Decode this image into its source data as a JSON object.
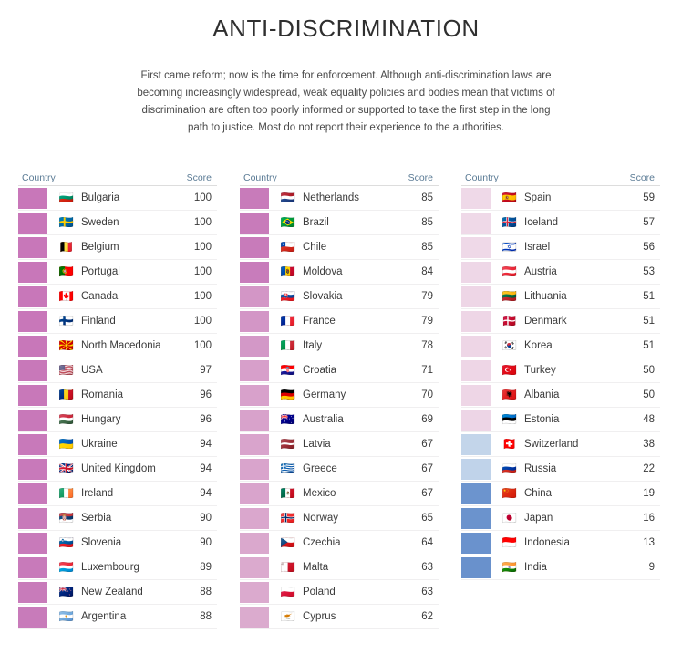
{
  "header": {
    "title": "ANTI-DISCRIMINATION",
    "intro": "First came reform; now is the time for enforcement. Although anti-discrimination laws are becoming increasingly widespread, weak equality policies and bodies mean that victims of discrimination are often too poorly informed or supported to take the first step in the long path to justice. Most do not report their experience to the authorities."
  },
  "columns": [
    {
      "headers": {
        "country": "Country",
        "score": "Score"
      },
      "rows": [
        {
          "country": "Bulgaria",
          "score": 100,
          "flag": "flag-bulgaria",
          "glyph": "🇧🇬",
          "color": "#c877b9"
        },
        {
          "country": "Sweden",
          "score": 100,
          "flag": "flag-sweden",
          "glyph": "🇸🇪",
          "color": "#c877b9"
        },
        {
          "country": "Belgium",
          "score": 100,
          "flag": "flag-belgium",
          "glyph": "🇧🇪",
          "color": "#c877b9"
        },
        {
          "country": "Portugal",
          "score": 100,
          "flag": "flag-portugal",
          "glyph": "🇵🇹",
          "color": "#c877b9"
        },
        {
          "country": "Canada",
          "score": 100,
          "flag": "flag-canada",
          "glyph": "🇨🇦",
          "color": "#c877b9"
        },
        {
          "country": "Finland",
          "score": 100,
          "flag": "flag-finland",
          "glyph": "🇫🇮",
          "color": "#c877b9"
        },
        {
          "country": "North Macedonia",
          "score": 100,
          "flag": "flag-north-macedonia",
          "glyph": "🇲🇰",
          "color": "#c877b9"
        },
        {
          "country": "USA",
          "score": 97,
          "flag": "flag-usa",
          "glyph": "🇺🇸",
          "color": "#c878b9"
        },
        {
          "country": "Romania",
          "score": 96,
          "flag": "flag-romania",
          "glyph": "🇷🇴",
          "color": "#c878b9"
        },
        {
          "country": "Hungary",
          "score": 96,
          "flag": "flag-hungary",
          "glyph": "🇭🇺",
          "color": "#c878b9"
        },
        {
          "country": "Ukraine",
          "score": 94,
          "flag": "flag-ukraine",
          "glyph": "🇺🇦",
          "color": "#c879ba"
        },
        {
          "country": "United Kingdom",
          "score": 94,
          "flag": "flag-united-kingdom",
          "glyph": "🇬🇧",
          "color": "#c879ba"
        },
        {
          "country": "Ireland",
          "score": 94,
          "flag": "flag-ireland",
          "glyph": "🇮🇪",
          "color": "#c879ba"
        },
        {
          "country": "Serbia",
          "score": 90,
          "flag": "flag-serbia",
          "glyph": "🇷🇸",
          "color": "#c87aba"
        },
        {
          "country": "Slovenia",
          "score": 90,
          "flag": "flag-slovenia",
          "glyph": "🇸🇮",
          "color": "#c87aba"
        },
        {
          "country": "Luxembourg",
          "score": 89,
          "flag": "flag-luxembourg",
          "glyph": "🇱🇺",
          "color": "#c87aba"
        },
        {
          "country": "New Zealand",
          "score": 88,
          "flag": "flag-new-zealand",
          "glyph": "🇳🇿",
          "color": "#c87bba"
        },
        {
          "country": "Argentina",
          "score": 88,
          "flag": "flag-argentina",
          "glyph": "🇦🇷",
          "color": "#c87bba"
        }
      ]
    },
    {
      "headers": {
        "country": "Country",
        "score": "Score"
      },
      "rows": [
        {
          "country": "Netherlands",
          "score": 85,
          "flag": "flag-netherlands",
          "glyph": "🇳🇱",
          "color": "#c87bba"
        },
        {
          "country": "Brazil",
          "score": 85,
          "flag": "flag-brazil",
          "glyph": "🇧🇷",
          "color": "#c87bba"
        },
        {
          "country": "Chile",
          "score": 85,
          "flag": "flag-chile",
          "glyph": "🇨🇱",
          "color": "#c87bba"
        },
        {
          "country": "Moldova",
          "score": 84,
          "flag": "flag-moldova",
          "glyph": "🇲🇩",
          "color": "#c87cbb"
        },
        {
          "country": "Slovakia",
          "score": 79,
          "flag": "flag-slovakia",
          "glyph": "🇸🇰",
          "color": "#d396c6"
        },
        {
          "country": "France",
          "score": 79,
          "flag": "flag-france",
          "glyph": "🇫🇷",
          "color": "#d396c6"
        },
        {
          "country": "Italy",
          "score": 78,
          "flag": "flag-italy",
          "glyph": "🇮🇹",
          "color": "#d398c7"
        },
        {
          "country": "Croatia",
          "score": 71,
          "flag": "flag-croatia",
          "glyph": "🇭🇷",
          "color": "#d79fca"
        },
        {
          "country": "Germany",
          "score": 70,
          "flag": "flag-germany",
          "glyph": "🇩🇪",
          "color": "#d8a1cb"
        },
        {
          "country": "Australia",
          "score": 69,
          "flag": "flag-australia",
          "glyph": "🇦🇺",
          "color": "#d8a2cb"
        },
        {
          "country": "Latvia",
          "score": 67,
          "flag": "flag-latvia",
          "glyph": "🇱🇻",
          "color": "#d9a4cc"
        },
        {
          "country": "Greece",
          "score": 67,
          "flag": "flag-greece",
          "glyph": "🇬🇷",
          "color": "#d9a4cc"
        },
        {
          "country": "Mexico",
          "score": 67,
          "flag": "flag-mexico",
          "glyph": "🇲🇽",
          "color": "#d9a4cc"
        },
        {
          "country": "Norway",
          "score": 65,
          "flag": "flag-norway",
          "glyph": "🇳🇴",
          "color": "#daa7cd"
        },
        {
          "country": "Czechia",
          "score": 64,
          "flag": "flag-czechia",
          "glyph": "🇨🇿",
          "color": "#daa8cd"
        },
        {
          "country": "Malta",
          "score": 63,
          "flag": "flag-malta",
          "glyph": "🇲🇹",
          "color": "#dbaace"
        },
        {
          "country": "Poland",
          "score": 63,
          "flag": "flag-poland",
          "glyph": "🇵🇱",
          "color": "#dbaace"
        },
        {
          "country": "Cyprus",
          "score": 62,
          "flag": "flag-cyprus",
          "glyph": "🇨🇾",
          "color": "#dbabce"
        }
      ]
    },
    {
      "headers": {
        "country": "Country",
        "score": "Score"
      },
      "rows": [
        {
          "country": "Spain",
          "score": 59,
          "flag": "flag-spain",
          "glyph": "🇪🇸",
          "color": "#efd9e8"
        },
        {
          "country": "Iceland",
          "score": 57,
          "flag": "flag-iceland",
          "glyph": "🇮🇸",
          "color": "#efd9e8"
        },
        {
          "country": "Israel",
          "score": 56,
          "flag": "flag-israel",
          "glyph": "🇮🇱",
          "color": "#efd9e8"
        },
        {
          "country": "Austria",
          "score": 53,
          "flag": "flag-austria",
          "glyph": "🇦🇹",
          "color": "#eed7e7"
        },
        {
          "country": "Lithuania",
          "score": 51,
          "flag": "flag-lithuania",
          "glyph": "🇱🇹",
          "color": "#eed6e6"
        },
        {
          "country": "Denmark",
          "score": 51,
          "flag": "flag-denmark",
          "glyph": "🇩🇰",
          "color": "#eed6e6"
        },
        {
          "country": "Korea",
          "score": 51,
          "flag": "flag-korea",
          "glyph": "🇰🇷",
          "color": "#eed6e6"
        },
        {
          "country": "Turkey",
          "score": 50,
          "flag": "flag-turkey",
          "glyph": "🇹🇷",
          "color": "#eed6e6"
        },
        {
          "country": "Albania",
          "score": 50,
          "flag": "flag-albania",
          "glyph": "🇦🇱",
          "color": "#eed6e6"
        },
        {
          "country": "Estonia",
          "score": 48,
          "flag": "flag-estonia",
          "glyph": "🇪🇪",
          "color": "#edd5e6"
        },
        {
          "country": "Switzerland",
          "score": 38,
          "flag": "flag-switzerland",
          "glyph": "🇨🇭",
          "color": "#c3d5ea"
        },
        {
          "country": "Russia",
          "score": 22,
          "flag": "flag-russia",
          "glyph": "🇷🇺",
          "color": "#c0d3ea"
        },
        {
          "country": "China",
          "score": 19,
          "flag": "flag-china",
          "glyph": "🇨🇳",
          "color": "#6c94ce"
        },
        {
          "country": "Japan",
          "score": 16,
          "flag": "flag-japan",
          "glyph": "🇯🇵",
          "color": "#6b93cd"
        },
        {
          "country": "Indonesia",
          "score": 13,
          "flag": "flag-indonesia",
          "glyph": "🇮🇩",
          "color": "#6a92cd"
        },
        {
          "country": "India",
          "score": 9,
          "flag": "flag-india",
          "glyph": "🇮🇳",
          "color": "#6991cc"
        }
      ]
    }
  ],
  "chart_data": {
    "type": "table",
    "title": "ANTI-DISCRIMINATION",
    "xlabel": "Country",
    "ylabel": "Score",
    "ylim": [
      0,
      100
    ],
    "colorscale": {
      "high": "#c877b9",
      "mid": "#dbabce",
      "low_light": "#c0d3ea",
      "low": "#6991cc"
    },
    "categories": [
      "Bulgaria",
      "Sweden",
      "Belgium",
      "Portugal",
      "Canada",
      "Finland",
      "North Macedonia",
      "USA",
      "Romania",
      "Hungary",
      "Ukraine",
      "United Kingdom",
      "Ireland",
      "Serbia",
      "Slovenia",
      "Luxembourg",
      "New Zealand",
      "Argentina",
      "Netherlands",
      "Brazil",
      "Chile",
      "Moldova",
      "Slovakia",
      "France",
      "Italy",
      "Croatia",
      "Germany",
      "Australia",
      "Latvia",
      "Greece",
      "Mexico",
      "Norway",
      "Czechia",
      "Malta",
      "Poland",
      "Cyprus",
      "Spain",
      "Iceland",
      "Israel",
      "Austria",
      "Lithuania",
      "Denmark",
      "Korea",
      "Turkey",
      "Albania",
      "Estonia",
      "Switzerland",
      "Russia",
      "China",
      "Japan",
      "Indonesia",
      "India"
    ],
    "values": [
      100,
      100,
      100,
      100,
      100,
      100,
      100,
      97,
      96,
      96,
      94,
      94,
      94,
      90,
      90,
      89,
      88,
      88,
      85,
      85,
      85,
      84,
      79,
      79,
      78,
      71,
      70,
      69,
      67,
      67,
      67,
      65,
      64,
      63,
      63,
      62,
      59,
      57,
      56,
      53,
      51,
      51,
      51,
      50,
      50,
      48,
      38,
      22,
      19,
      16,
      13,
      9
    ]
  }
}
